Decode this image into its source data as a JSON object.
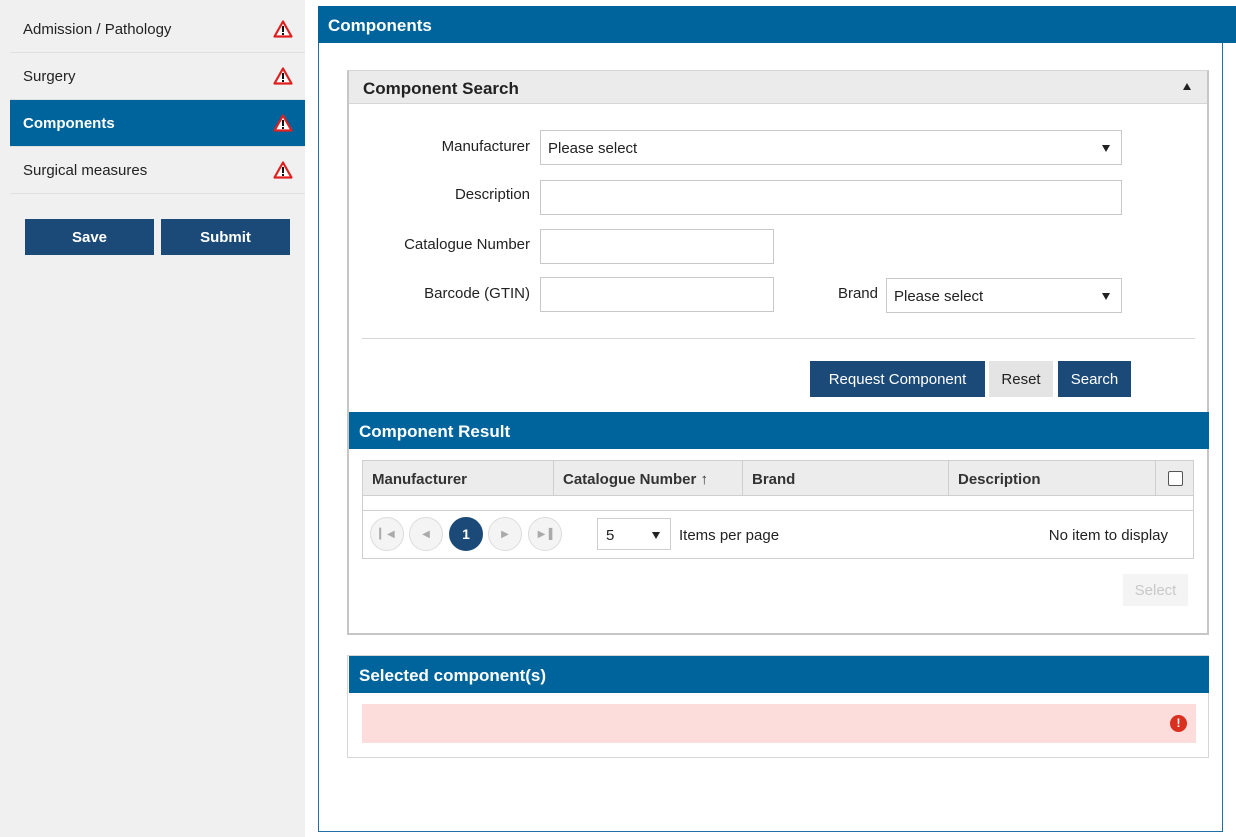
{
  "sidebar": {
    "items": [
      {
        "label": "Admission / Pathology",
        "active": false,
        "status_icon": "warning-triangle-icon"
      },
      {
        "label": "Surgery",
        "active": false,
        "status_icon": "warning-triangle-icon"
      },
      {
        "label": "Components",
        "active": true,
        "status_icon": "warning-triangle-icon"
      },
      {
        "label": "Surgical measures",
        "active": false,
        "status_icon": "warning-triangle-icon"
      }
    ],
    "save_label": "Save",
    "submit_label": "Submit"
  },
  "main": {
    "title": "Components"
  },
  "search": {
    "title": "Component Search",
    "manufacturer_label": "Manufacturer",
    "manufacturer_value": "Please select",
    "description_label": "Description",
    "description_value": "",
    "catalogue_label": "Catalogue Number",
    "catalogue_value": "",
    "barcode_label": "Barcode (GTIN)",
    "barcode_value": "",
    "brand_label": "Brand",
    "brand_value": "Please select",
    "request_label": "Request Component",
    "reset_label": "Reset",
    "search_label": "Search"
  },
  "result": {
    "title": "Component Result",
    "columns": [
      "Manufacturer",
      "Catalogue Number ↑",
      "Brand",
      "Description"
    ],
    "current_page": "1",
    "page_size": "5",
    "items_per_page_label": "Items per page",
    "empty_label": "No item to display",
    "select_label": "Select"
  },
  "selected": {
    "title": "Selected component(s)"
  },
  "colors": {
    "header_blue": "#00649c",
    "button_navy": "#1b4a78",
    "warning_red": "#e02020",
    "error_bg": "#fddcdc"
  }
}
